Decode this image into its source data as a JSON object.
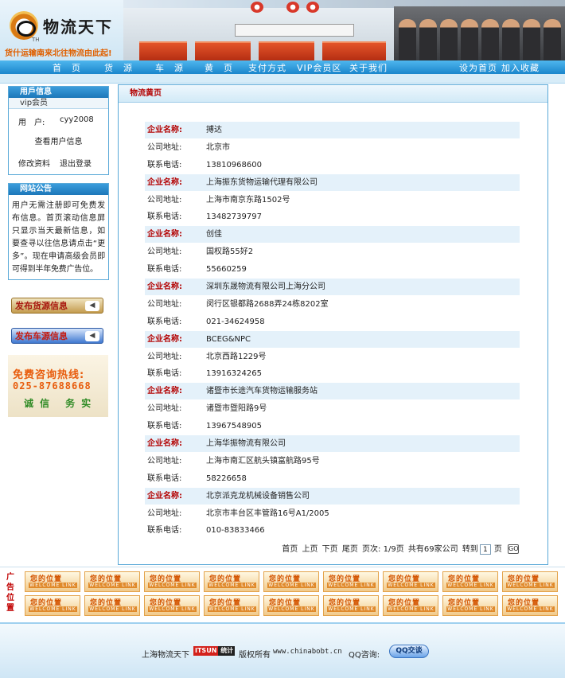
{
  "header": {
    "site_name": "物流天下",
    "logo_tag": "TH",
    "slogan": "货什运输南来北往物流由此起!"
  },
  "nav": {
    "items": [
      "首　页",
      "货　源",
      "车　源",
      "黄　页",
      "支付方式",
      "VIP会员区",
      "关于我们"
    ],
    "right": [
      "设为首页",
      "加入收藏"
    ]
  },
  "user_box": {
    "title": "用戶信息",
    "vip_label": "vip会员",
    "user_label": "用　户:",
    "username": "cyy2008",
    "view_info": "查看用户信息",
    "edit_profile": "修改资料",
    "logout": "退出登录"
  },
  "notice_box": {
    "title": "网站公告",
    "text": "用户无需注册即可免费发布信息。首页滚动信息屏只显示当天最新信息，如要查寻以往信息请点击“更多”。现在申请高级会员即可得到半年免费广告位。"
  },
  "publish": {
    "goods": "发布货源信息",
    "cars": "发布车源信息"
  },
  "hotline": {
    "title": "免费咨询热线:",
    "phone": "025-87688668",
    "motto": "诚信 务实"
  },
  "main": {
    "title": "物流黄页",
    "labels": {
      "name": "企业名称:",
      "address": "公司地址:",
      "phone": "联系电话:"
    },
    "companies": [
      {
        "name": "搏达",
        "address": "北京市",
        "phone": "13810968600"
      },
      {
        "name": "上海振东货物运输代理有限公司",
        "address": "上海市南京东路1502号",
        "phone": "13482739797"
      },
      {
        "name": "创佳",
        "address": "国权路55好2",
        "phone": "55660259"
      },
      {
        "name": "深圳东晟物流有限公司上海分公司",
        "address": "闵行区银都路2688弄24栋8202室",
        "phone": "021-34624958"
      },
      {
        "name": "BCEG&NPC",
        "address": "北京西路1229号",
        "phone": "13916324265"
      },
      {
        "name": "诸暨市长途汽车货物运输服务站",
        "address": "诸暨市暨阳路9号",
        "phone": "13967548905"
      },
      {
        "name": "上海华振物流有限公司",
        "address": "上海市南汇区航头镇富航路95号",
        "phone": "58226658"
      },
      {
        "name": "北京派克龙机械设备销售公司",
        "address": "北京市丰台区丰管路16号A1/2005",
        "phone": "010-83833466"
      }
    ],
    "pager": {
      "first": "首页",
      "prev": "上页",
      "next": "下页",
      "last": "尾页",
      "page_info": "页次: 1/9页",
      "total": "共有69家公司",
      "goto": "转到",
      "page_value": "1",
      "page_suffix": "页",
      "go": "GO"
    }
  },
  "ads": {
    "label": "广告位置",
    "cell_text": "您的位置",
    "cell_sub": "WELCOME LINK",
    "rows": 2,
    "cols": 9
  },
  "footer": {
    "org": "上海物流天下",
    "badge_a": "ITSUN",
    "badge_b": "统计",
    "rights": "版权所有",
    "url": "www.chinabobt.cn",
    "qq_label": "QQ咨询:",
    "qq_button": "QQ交谈"
  },
  "colors": {
    "nav": "#1a86cc",
    "title_red": "#b30000",
    "accent_orange": "#e85b0b",
    "row_tint": "#e4f1fa"
  }
}
